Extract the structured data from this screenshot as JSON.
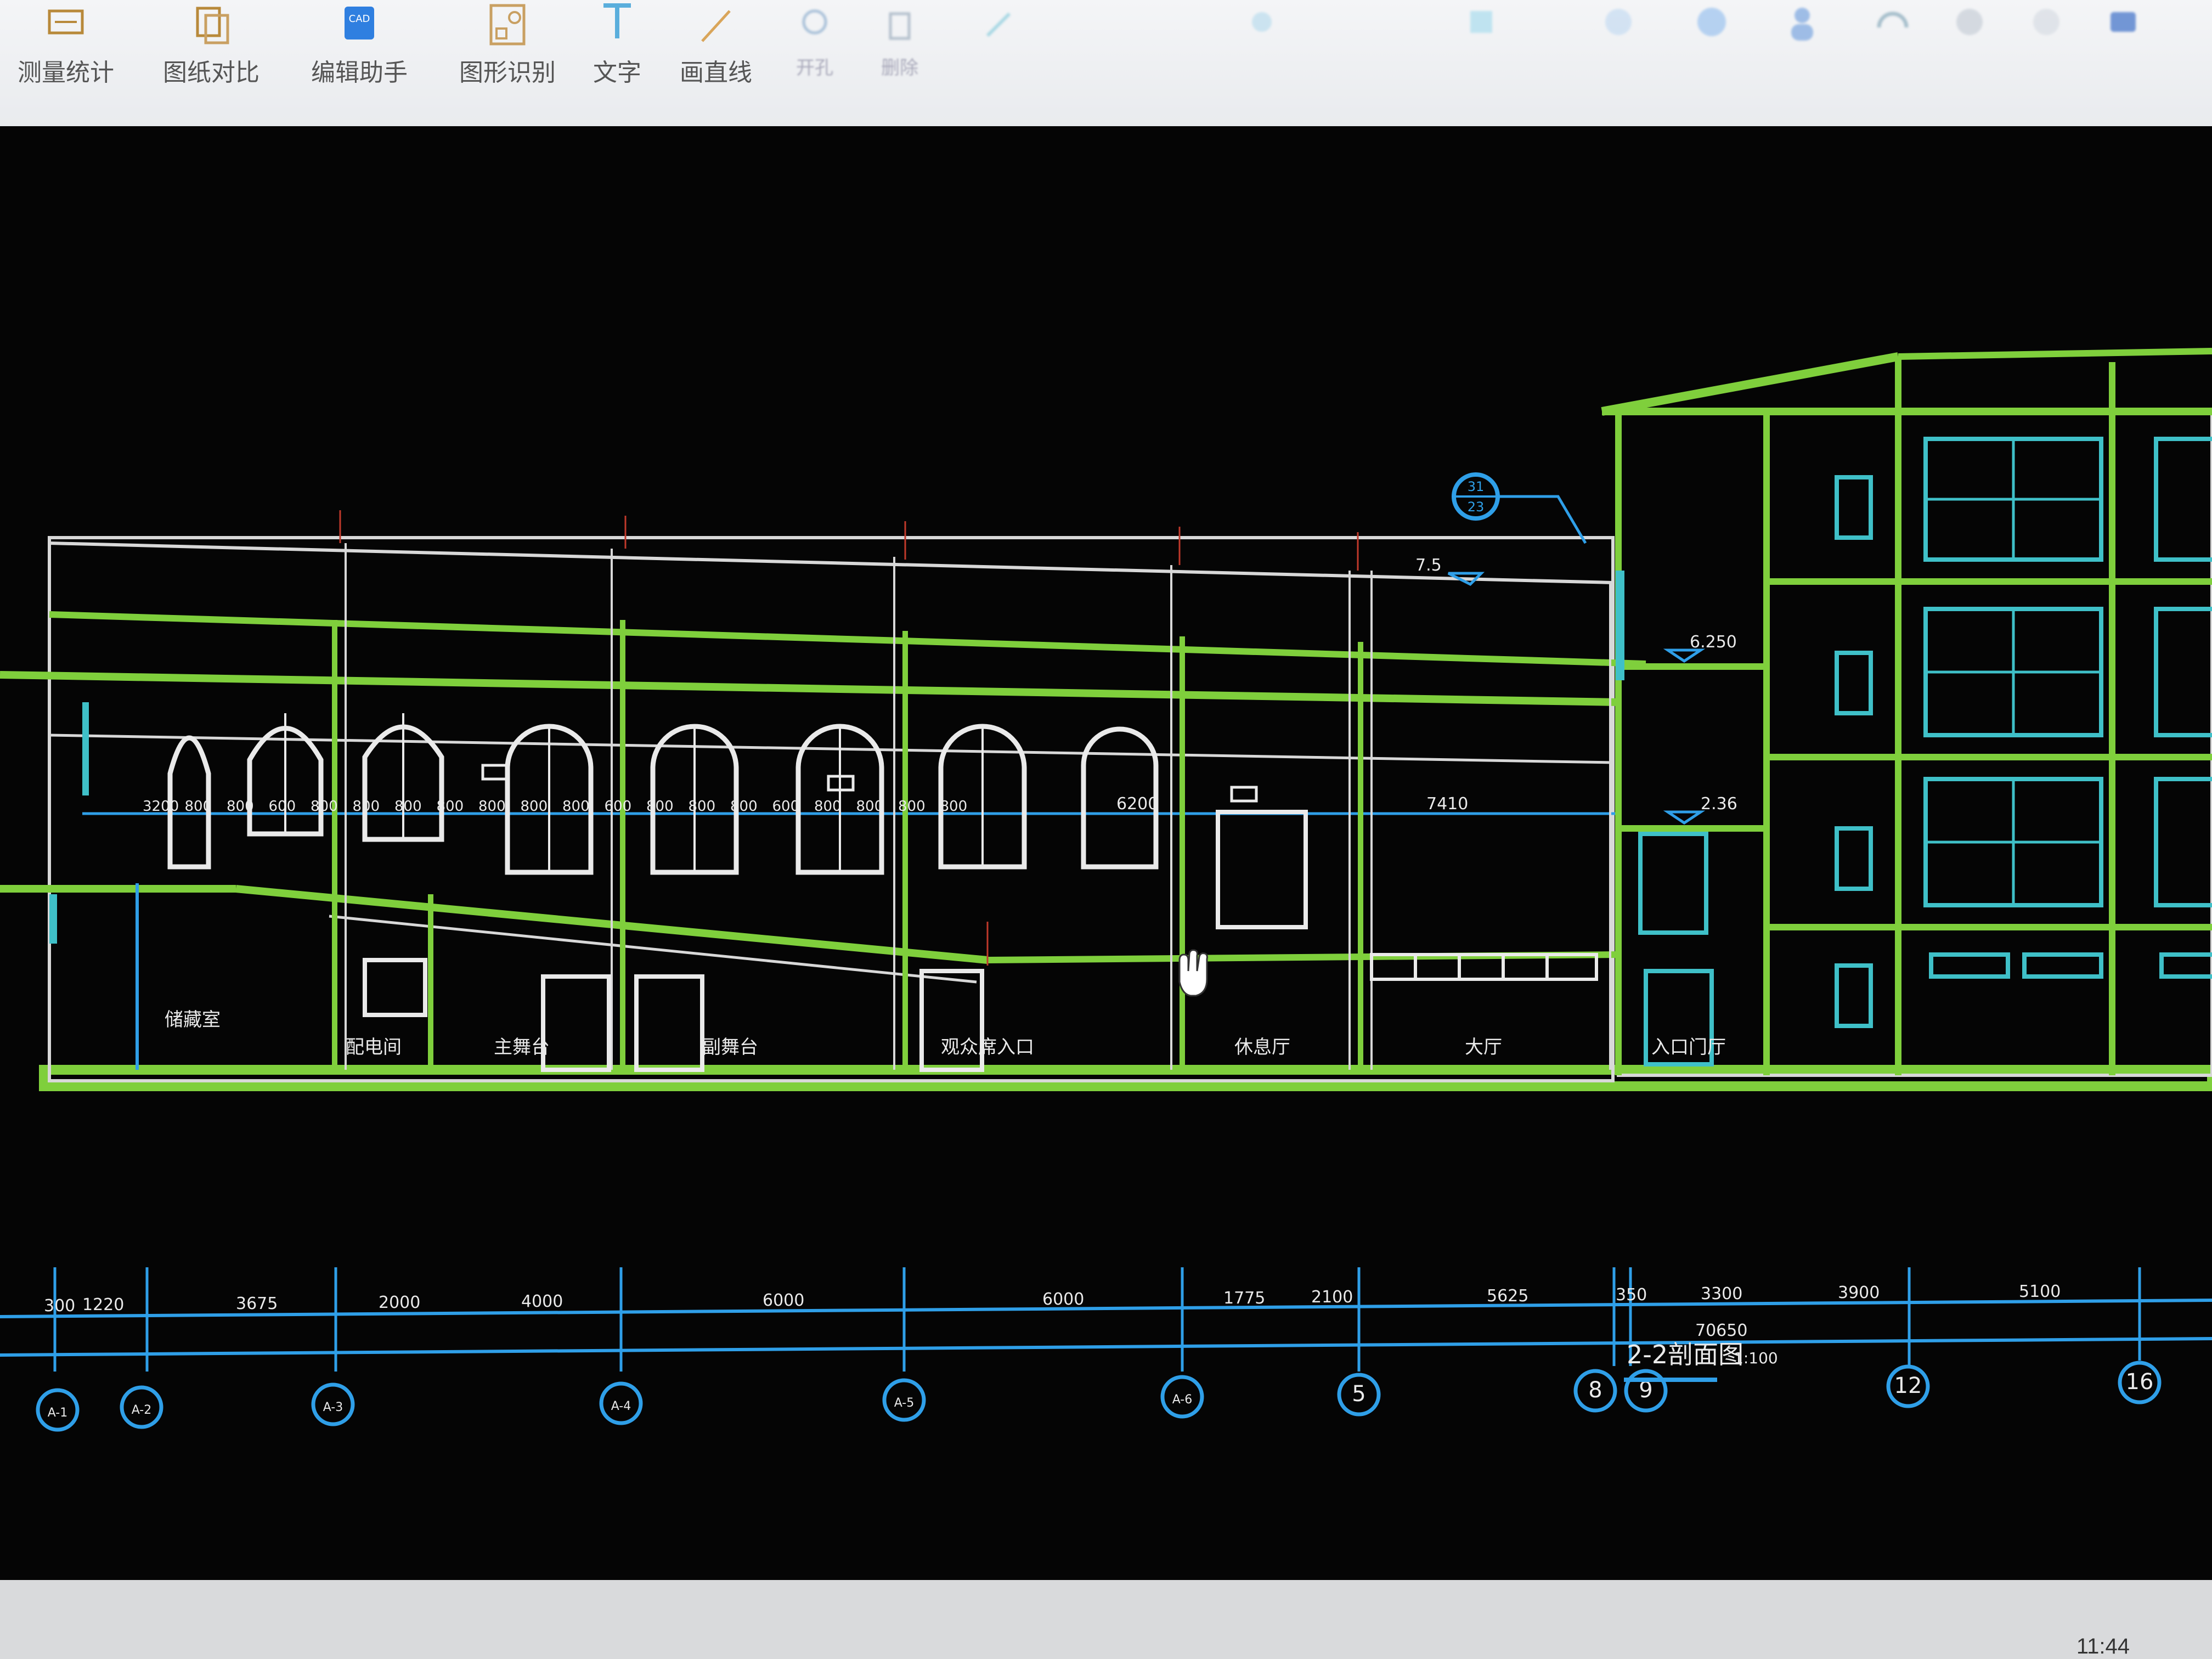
{
  "toolbar": {
    "items": [
      {
        "label": "测量统计",
        "icon": "measure-icon"
      },
      {
        "label": "图纸对比",
        "icon": "compare-icon"
      },
      {
        "label": "编辑助手",
        "icon": "cad-edit-icon"
      },
      {
        "label": "图形识别",
        "icon": "shape-recognize-icon"
      },
      {
        "label": "文字",
        "icon": "text-icon"
      },
      {
        "label": "画直线",
        "icon": "line-icon"
      },
      {
        "label": "开孔",
        "icon": "hole-icon"
      },
      {
        "label": "删除",
        "icon": "delete-icon"
      }
    ]
  },
  "drawing": {
    "title": "2-2剖面图",
    "scale": "1:100",
    "elevation_labels": [
      "7.5",
      "6.250",
      "2.36"
    ],
    "detail_callout": {
      "top": "31",
      "bottom": "23"
    },
    "window_module_labels": [
      "3200",
      "800",
      "800",
      "600",
      "800",
      "800",
      "800",
      "800",
      "800",
      "800",
      "800",
      "600",
      "800",
      "800",
      "800",
      "600",
      "800",
      "800",
      "800",
      "800"
    ],
    "interior_dim_labels": [
      "6200",
      "7410"
    ],
    "bottom_dims": [
      "300",
      "1220",
      "3675",
      "2000",
      "4000",
      "6000",
      "6000",
      "1775",
      "2100",
      "5625",
      "350",
      "3300",
      "3900",
      "5100"
    ],
    "total_dim": "70650",
    "axes": [
      "A-1",
      "A-2",
      "A-3",
      "A-4",
      "A-5",
      "A-6",
      "5",
      "8",
      "9",
      "12",
      "16"
    ],
    "rooms": [
      "储藏室",
      "配电间",
      "主舞台",
      "副舞台",
      "观众席入口",
      "休息厅",
      "大厅",
      "入口门厅"
    ]
  },
  "taskbar": {
    "time": "11:44"
  },
  "colors": {
    "green": "#7fcf3c",
    "cyan": "#2f9fe8",
    "teal": "#3fc0c8",
    "white": "#e6e6e6",
    "red": "#c0392b"
  }
}
